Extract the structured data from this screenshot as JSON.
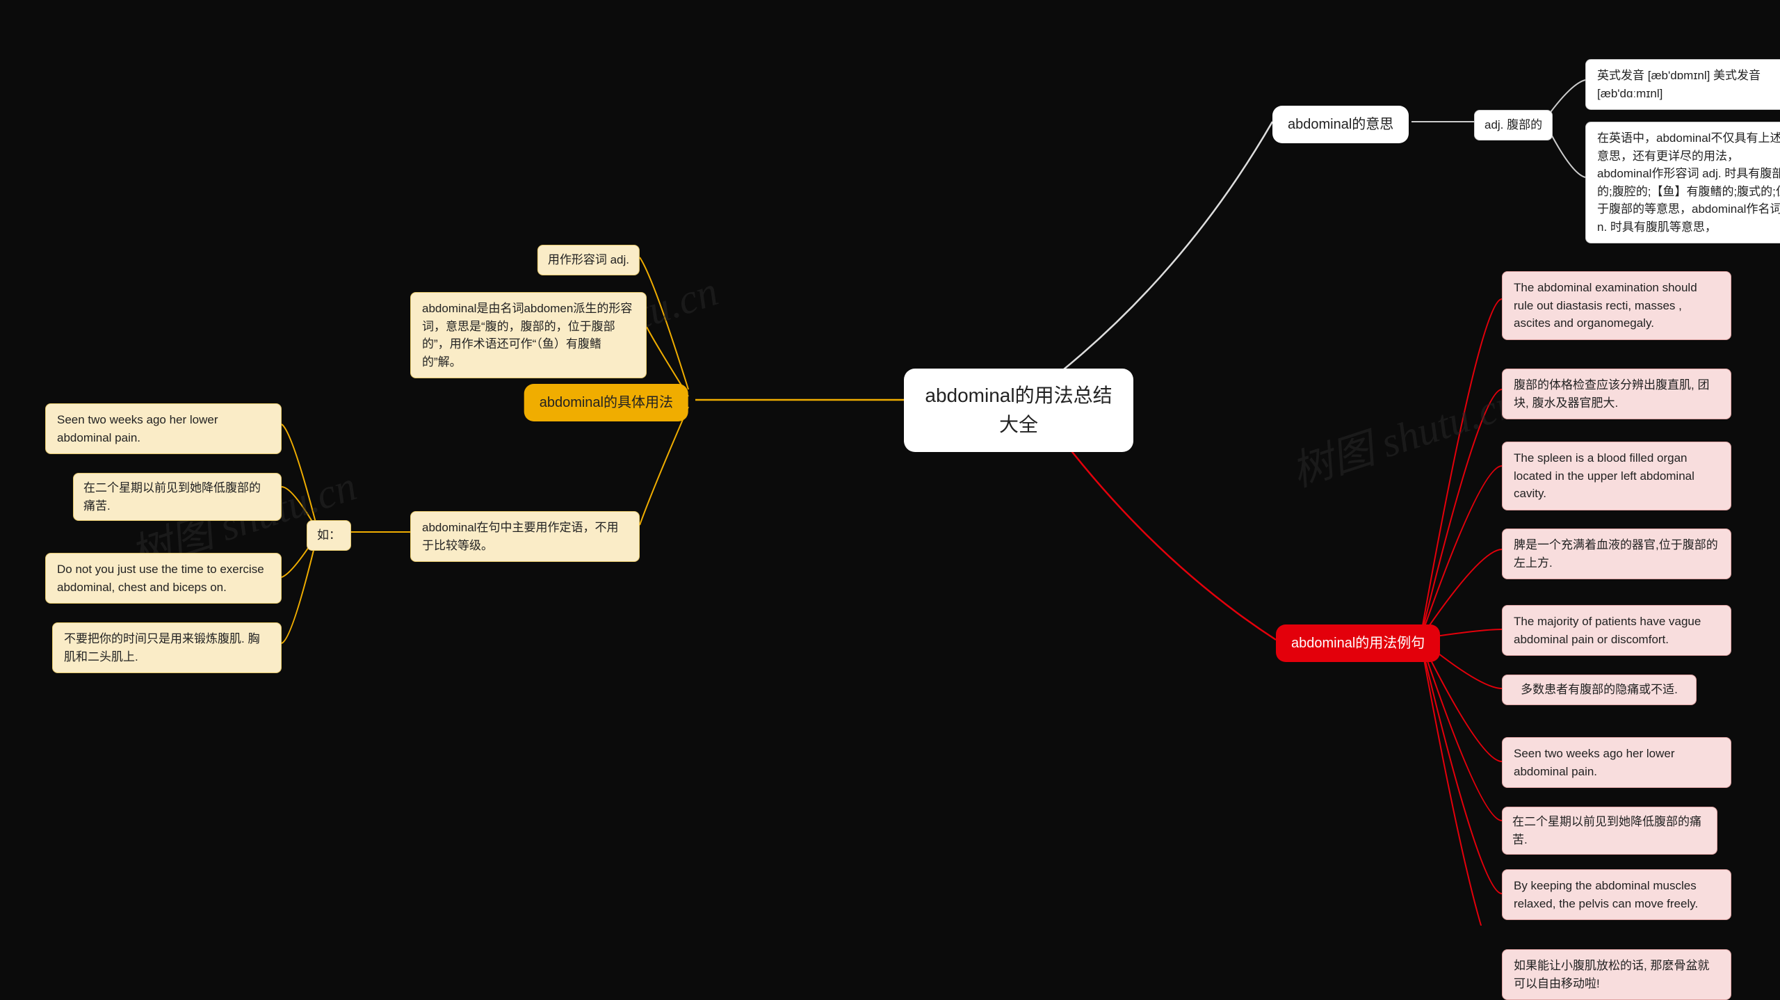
{
  "center": {
    "title": "abdominal的用法总结大全"
  },
  "watermark": "树图 shutu.cn",
  "branches": {
    "usage": {
      "label": "abdominal的具体用法",
      "children": [
        {
          "text": "用作形容词 adj."
        },
        {
          "text": "abdominal是由名词abdomen派生的形容词，意思是“腹的，腹部的，位于腹部的”，用作术语还可作“（鱼）有腹鳍的”解。"
        },
        {
          "text": "abdominal在句中主要用作定语，不用于比较等级。"
        }
      ],
      "example_label": "如：",
      "examples": [
        {
          "text": "Seen two weeks ago her lower abdominal pain."
        },
        {
          "text": "在二个星期以前见到她降低腹部的痛苦."
        },
        {
          "text": "Do not you just use the time to exercise abdominal, chest and biceps on."
        },
        {
          "text": "不要把你的时间只是用来锻炼腹肌. 胸肌和二头肌上."
        }
      ]
    },
    "meaning": {
      "label": "abdominal的意思",
      "sub_label": "adj. 腹部的",
      "leaves": [
        {
          "text": "英式发音 [æb'dɒmɪnl]  美式发音 [æb'dɑːmɪnl]"
        },
        {
          "text": "在英语中，abdominal不仅具有上述意思，还有更详尽的用法，abdominal作形容词 adj. 时具有腹部的;腹腔的;【鱼】有腹鳍的;腹式的;位于腹部的等意思，abdominal作名词 n. 时具有腹肌等意思，"
        }
      ]
    },
    "sentences": {
      "label": "abdominal的用法例句",
      "leaves": [
        {
          "text": "The abdominal examination should rule out diastasis recti, masses , ascites and organomegaly."
        },
        {
          "text": "腹部的体格检查应该分辨出腹直肌, 团块, 腹水及器官肥大."
        },
        {
          "text": "The spleen is a blood filled organ located in the upper left abdominal cavity."
        },
        {
          "text": "脾是一个充满着血液的器官,位于腹部的左上方."
        },
        {
          "text": "The majority of patients have vague abdominal pain or discomfort."
        },
        {
          "text": "多数患者有腹部的隐痛或不适."
        },
        {
          "text": "Seen two weeks ago her lower abdominal pain."
        },
        {
          "text": "在二个星期以前见到她降低腹部的痛苦."
        },
        {
          "text": "By keeping the abdominal muscles relaxed, the pelvis can move freely."
        },
        {
          "text": "如果能让小腹肌放松的话, 那麽骨盆就可以自由移动啦!"
        }
      ]
    }
  }
}
